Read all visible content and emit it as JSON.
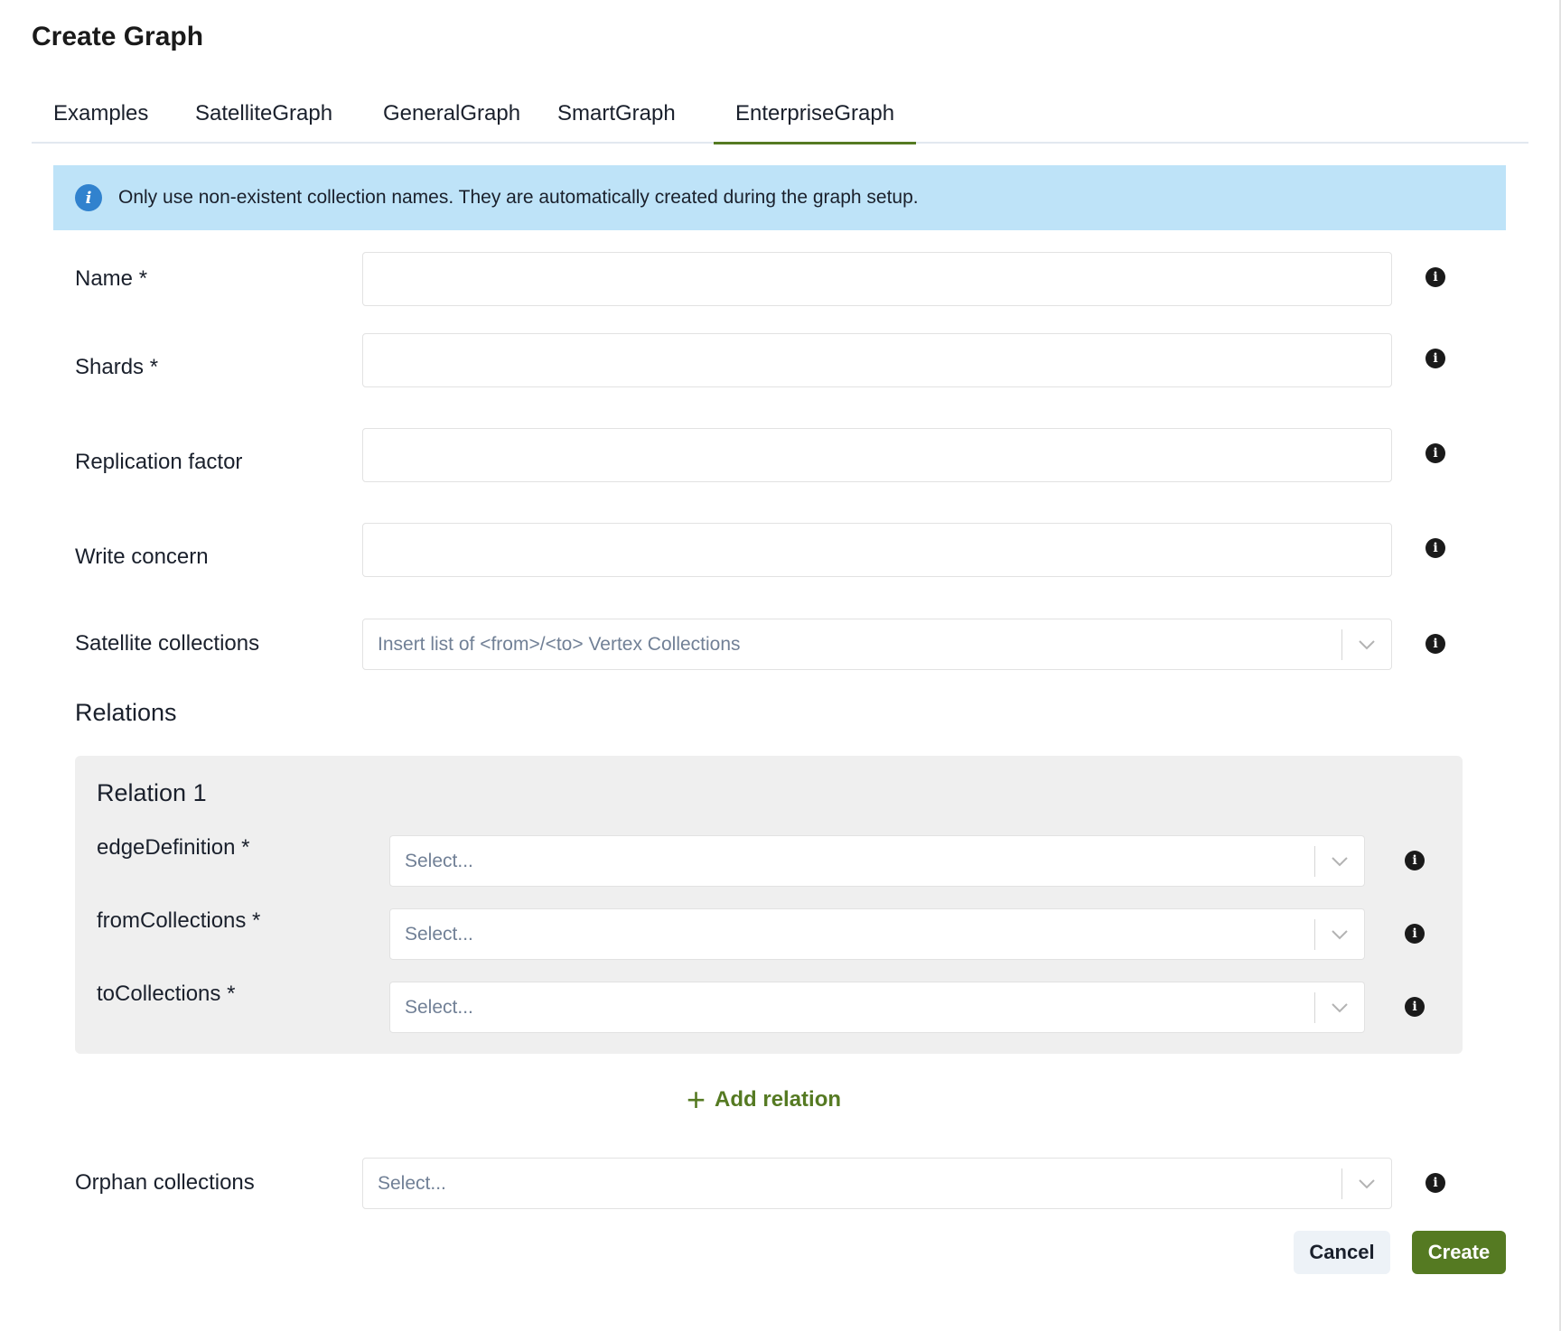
{
  "dialog": {
    "title": "Create Graph"
  },
  "tabs": [
    {
      "label": "Examples"
    },
    {
      "label": "SatelliteGraph"
    },
    {
      "label": "GeneralGraph"
    },
    {
      "label": "SmartGraph"
    },
    {
      "label": "EnterpriseGraph",
      "active": true
    }
  ],
  "alert": {
    "text": "Only use non-existent collection names. They are automatically created during the graph setup."
  },
  "form": {
    "name_label": "Name *",
    "name_value": "",
    "shards_label": "Shards *",
    "shards_value": "",
    "replication_label": "Replication factor",
    "replication_value": "",
    "write_concern_label": "Write concern",
    "write_concern_value": "",
    "satellite_label": "Satellite collections",
    "satellite_placeholder": "Insert list of <from>/<to> Vertex Collections",
    "orphan_label": "Orphan collections",
    "orphan_placeholder": "Select..."
  },
  "relations": {
    "title": "Relations",
    "items": [
      {
        "title": "Relation 1",
        "edge_label": "edgeDefinition *",
        "edge_placeholder": "Select...",
        "from_label": "fromCollections *",
        "from_placeholder": "Select...",
        "to_label": "toCollections *",
        "to_placeholder": "Select..."
      }
    ],
    "add_label": "Add relation"
  },
  "buttons": {
    "cancel": "Cancel",
    "create": "Create"
  },
  "icons": {
    "info": "info-icon",
    "chevron": "chevron-down-icon",
    "plus": "plus-icon"
  },
  "colors": {
    "accent": "#557a22",
    "alert_bg": "#bee3f8",
    "alert_icon": "#3182ce",
    "relation_bg": "#efefef"
  }
}
